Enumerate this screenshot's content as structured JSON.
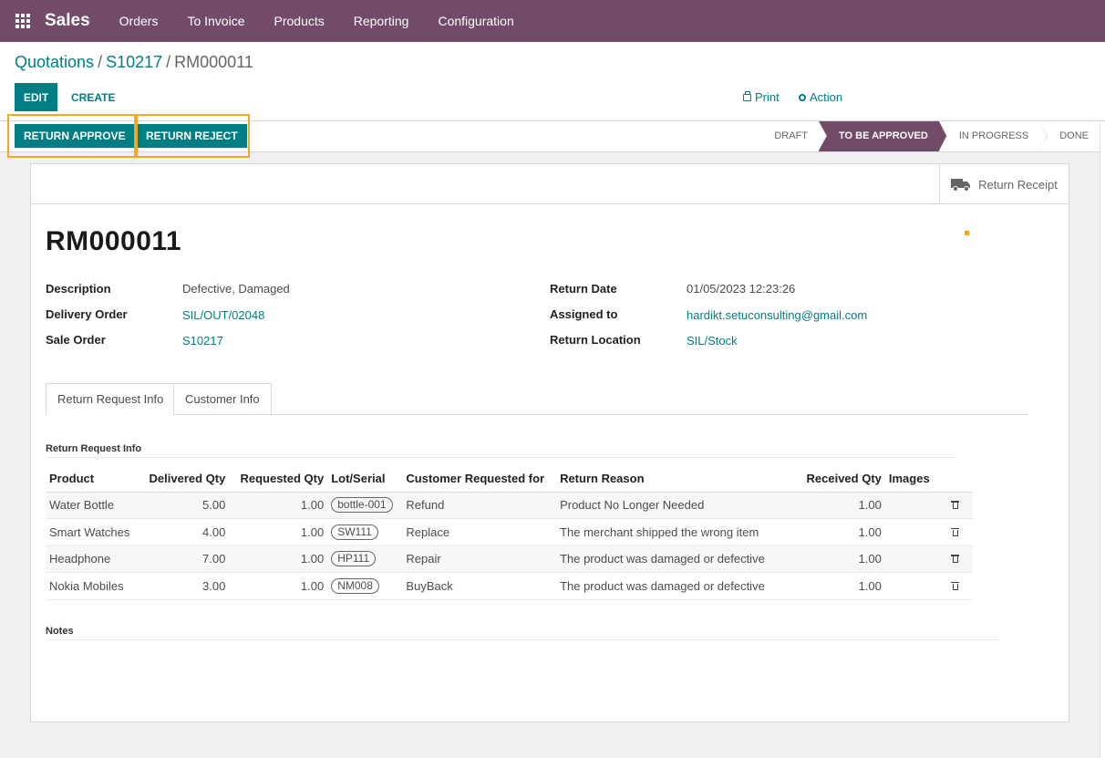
{
  "navbar": {
    "app_name": "Sales",
    "items": [
      "Orders",
      "To Invoice",
      "Products",
      "Reporting",
      "Configuration"
    ]
  },
  "breadcrumb": {
    "parent": "Quotations",
    "order": "S10217",
    "current": "RM000011"
  },
  "toolbar": {
    "edit_label": "EDIT",
    "create_label": "CREATE",
    "print_label": "Print",
    "action_label": "Action"
  },
  "statusbar": {
    "approve_label": "RETURN APPROVE",
    "reject_label": "RETURN REJECT",
    "stages": [
      "DRAFT",
      "TO BE APPROVED",
      "IN PROGRESS",
      "DONE"
    ],
    "active_stage": "TO BE APPROVED"
  },
  "smart_button": {
    "label": "Return Receipt",
    "icon": "truck-icon"
  },
  "record": {
    "name": "RM000011",
    "description_label": "Description",
    "description": "Defective, Damaged",
    "delivery_order_label": "Delivery Order",
    "delivery_order": "SIL/OUT/02048",
    "sale_order_label": "Sale Order",
    "sale_order": "S10217",
    "return_date_label": "Return Date",
    "return_date": "01/05/2023 12:23:26",
    "assigned_to_label": "Assigned to",
    "assigned_to": "hardikt.setuconsulting@gmail.com",
    "return_location_label": "Return Location",
    "return_location": "SIL/Stock"
  },
  "tabs": [
    "Return Request Info",
    "Customer Info"
  ],
  "section_title": "Return Request Info",
  "table": {
    "headers": [
      "Product",
      "Delivered Qty",
      "Requested Qty",
      "Lot/Serial",
      "Customer Requested for",
      "Return Reason",
      "Received Qty",
      "Images"
    ],
    "rows": [
      [
        "Water Bottle",
        "5.00",
        "1.00",
        "bottle-001",
        "Refund",
        "Product No Longer Needed",
        "1.00"
      ],
      [
        "Smart Watches",
        "4.00",
        "1.00",
        "SW111",
        "Replace",
        "The merchant shipped the wrong item",
        "1.00"
      ],
      [
        "Headphone",
        "7.00",
        "1.00",
        "HP111",
        "Repair",
        "The product was damaged or defective",
        "1.00"
      ],
      [
        "Nokia Mobiles",
        "3.00",
        "1.00",
        "NM008",
        "BuyBack",
        "The product was damaged or defective",
        "1.00"
      ]
    ]
  },
  "notes_title": "Notes",
  "colors": {
    "brand": "#714b67",
    "primary": "#017e84",
    "highlight": "#f5a623"
  }
}
